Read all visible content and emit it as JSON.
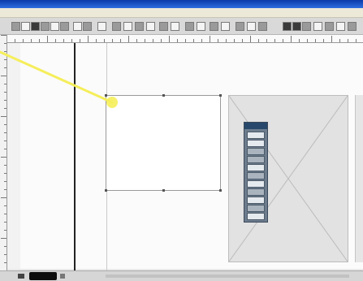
{
  "window": {
    "title": "",
    "title_bar_color": "#0b3aa8"
  },
  "menubar": {
    "items": [
      "",
      "",
      "",
      "",
      "",
      "",
      "",
      ""
    ]
  },
  "document": {
    "text_frame": {
      "text": ""
    }
  },
  "annotation": {
    "pointer_color": "#f5ee5a"
  },
  "icons": {
    "palette_tools": [
      "select-tool-icon",
      "direct-select-tool-icon",
      "text-tool-icon",
      "line-tool-icon",
      "pen-tool-icon",
      "rectangle-tool-icon",
      "ellipse-tool-icon",
      "rotate-tool-icon",
      "scale-tool-icon",
      "hand-tool-icon",
      "zoom-tool-icon",
      "fill-stroke-icon"
    ]
  }
}
